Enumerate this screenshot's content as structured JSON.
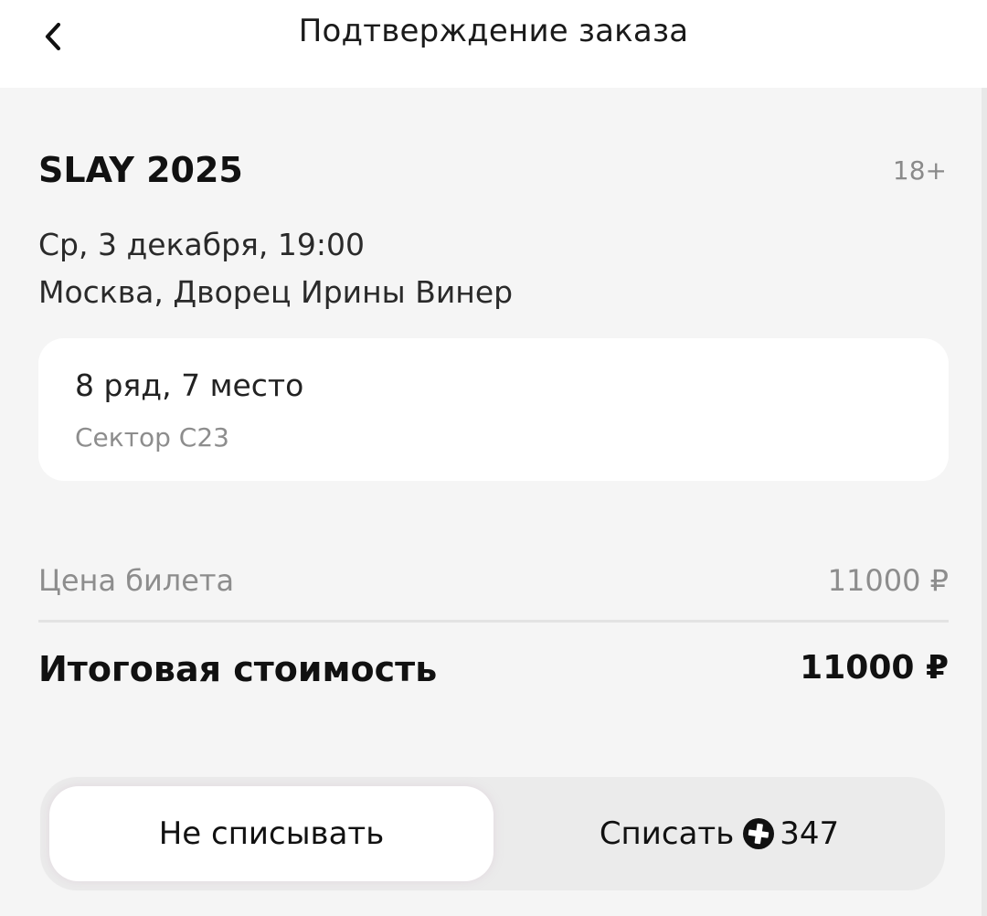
{
  "header": {
    "title": "Подтверждение заказа",
    "back_icon": "chevron-left-icon"
  },
  "event": {
    "title": "SLAY 2025",
    "age_rating": "18+",
    "date": "Ср, 3 декабря, 19:00",
    "venue": "Москва, Дворец Ирины Винер"
  },
  "seat": {
    "main": "8 ряд, 7 место",
    "sector": "Сектор C23"
  },
  "pricing": {
    "ticket_price_label": "Цена билета",
    "ticket_price_value": "11000 ₽",
    "total_label": "Итоговая стоимость",
    "total_value": "11000 ₽"
  },
  "points_toggle": {
    "options": [
      {
        "label": "Не списывать",
        "selected": true
      },
      {
        "label": "Списать",
        "icon": "plus-points-icon",
        "points": "347",
        "selected": false
      }
    ]
  },
  "colors": {
    "background": "#f5f5f5",
    "card": "#ffffff",
    "muted_text": "#8d8d8d",
    "primary_text": "#111111"
  }
}
